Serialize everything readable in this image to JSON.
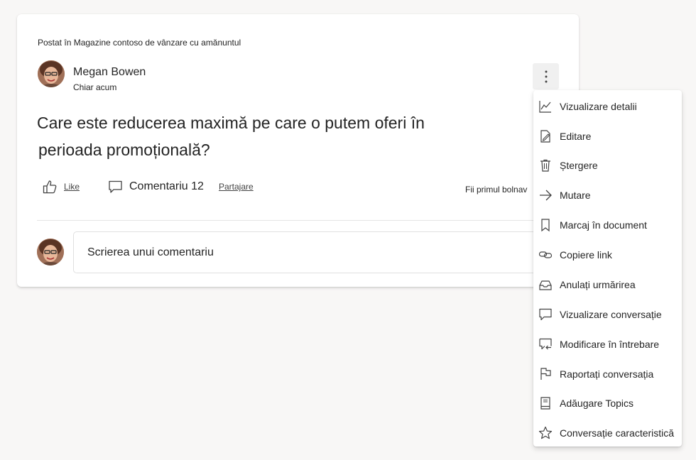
{
  "post": {
    "posted_in": "Postat în Magazine contoso de vânzare cu amănuntul",
    "author": "Megan Bowen",
    "timestamp": "Chiar acum",
    "question_line1": "Care este reducerea maximă pe care o putem oferi în",
    "question_line2": "perioada promoțională?",
    "actions": {
      "like": "Like",
      "comment": "Comentariu 12",
      "share": "Partajare",
      "first_like": "Fii primul bolnav"
    },
    "comment_placeholder": "Scrierea unui comentariu"
  },
  "menu": {
    "items": [
      {
        "label": "Vizualizare detalii",
        "icon": "chart-line-icon"
      },
      {
        "label": "Editare",
        "icon": "edit-icon"
      },
      {
        "label": "Ștergere",
        "icon": "trash-icon"
      },
      {
        "label": "Mutare",
        "icon": "arrow-right-icon"
      },
      {
        "label": "Marcaj în document",
        "icon": "bookmark-icon"
      },
      {
        "label": "Copiere link",
        "icon": "link-icon"
      },
      {
        "label": "Anulați urmărirea",
        "icon": "inbox-icon"
      },
      {
        "label": "Vizualizare conversație",
        "icon": "chat-icon"
      },
      {
        "label": "Modificare în întrebare",
        "icon": "chat-arrow-icon"
      },
      {
        "label": "Raportați conversația",
        "icon": "flag-icon"
      },
      {
        "label": "Adăugare Topics",
        "icon": "book-icon"
      },
      {
        "label": "Conversație caracteristică",
        "icon": "star-icon"
      }
    ]
  },
  "colors": {
    "background": "#f8f7f6",
    "card": "#ffffff",
    "text": "#242424",
    "more_button_bg": "#f0f0f0"
  }
}
